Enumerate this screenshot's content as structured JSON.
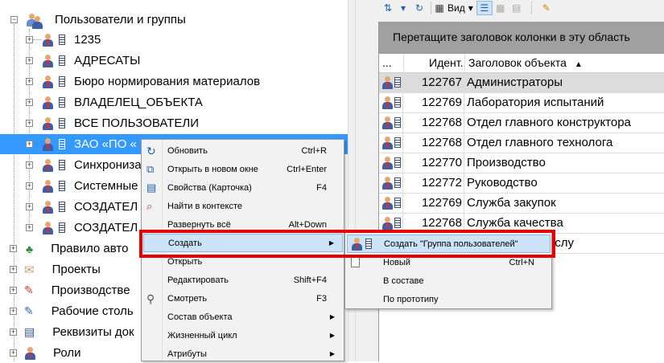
{
  "tree": {
    "root": {
      "label": "Пользователи и группы"
    },
    "children": [
      {
        "label": "1235"
      },
      {
        "label": "АДРЕСАТЫ"
      },
      {
        "label": "Бюро нормирования материалов"
      },
      {
        "label": "ВЛАДЕЛЕЦ_ОБЪЕКТА"
      },
      {
        "label": "ВСЕ ПОЛЬЗОВАТЕЛИ"
      },
      {
        "label": "ЗАО «ПО «"
      },
      {
        "label": "Синхрониза"
      },
      {
        "label": "Системные"
      },
      {
        "label": "СОЗДАТЕЛ"
      },
      {
        "label": "СОЗДАТЕЛ"
      }
    ],
    "siblings": [
      {
        "label": "Правило авто"
      },
      {
        "label": "Проекты"
      },
      {
        "label": "Производстве"
      },
      {
        "label": "Рабочие столь"
      },
      {
        "label": "Реквизиты док"
      },
      {
        "label": "Роли"
      }
    ]
  },
  "toolbar": {
    "view_label": "Вид"
  },
  "grid": {
    "group_hint": "Перетащите заголовок колонки в эту область",
    "columns": [
      "...",
      "Идент...",
      "Заголовок объекта"
    ],
    "rows": [
      {
        "id": "122767",
        "title": "Администраторы"
      },
      {
        "id": "122769",
        "title": "Лаборатория испытаний"
      },
      {
        "id": "122768",
        "title": "Отдел главного конструктора"
      },
      {
        "id": "122768",
        "title": "Отдел главного технолога"
      },
      {
        "id": "122770",
        "title": "Производство"
      },
      {
        "id": "122772",
        "title": "Руководство"
      },
      {
        "id": "122769",
        "title": "Служба закупок"
      },
      {
        "id": "122768",
        "title": "Служба качества"
      },
      {
        "id": "",
        "title": "экономическая слу"
      }
    ]
  },
  "context_menu": {
    "items": [
      {
        "label": "Обновить",
        "shortcut": "Ctrl+R"
      },
      {
        "label": "Открыть в новом окне",
        "shortcut": "Ctrl+Enter"
      },
      {
        "label": "Свойства (Карточка)",
        "shortcut": "F4"
      },
      {
        "label": "Найти в контексте",
        "shortcut": ""
      },
      {
        "label": "Развернуть всё",
        "shortcut": "Alt+Down"
      },
      {
        "label": "Создать",
        "shortcut": ""
      },
      {
        "label": "Открыть",
        "shortcut": ""
      },
      {
        "label": "Редактировать",
        "shortcut": "Shift+F4"
      },
      {
        "label": "Смотреть",
        "shortcut": "F3"
      },
      {
        "label": "Состав объекта",
        "shortcut": ""
      },
      {
        "label": "Жизненный цикл",
        "shortcut": ""
      },
      {
        "label": "Атрибуты",
        "shortcut": ""
      }
    ]
  },
  "submenu": {
    "items": [
      {
        "label": "Создать \"Группа пользователей\"",
        "shortcut": ""
      },
      {
        "label": "Новый",
        "shortcut": "Ctrl+N"
      },
      {
        "label": "В составе",
        "shortcut": ""
      },
      {
        "label": "По прототипу",
        "shortcut": ""
      }
    ]
  },
  "colors": {
    "selection": "#3399ff",
    "highlight_box": "#e60000",
    "group_panel": "#a0a0a0"
  }
}
